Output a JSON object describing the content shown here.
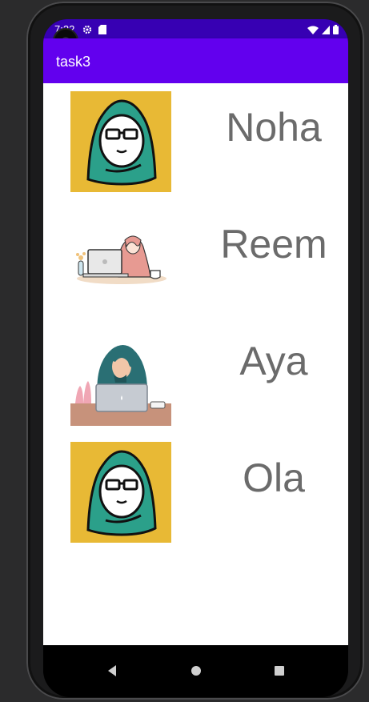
{
  "status_bar": {
    "time": "7:22"
  },
  "app_bar": {
    "title": "task3"
  },
  "list": [
    {
      "name": "Noha",
      "avatar": "hijab-glasses-yellow-avatar"
    },
    {
      "name": "Reem",
      "avatar": "woman-laptop-coffee-illustration"
    },
    {
      "name": "Aya",
      "avatar": "woman-laptop-desk-illustration"
    },
    {
      "name": "Ola",
      "avatar": "hijab-glasses-yellow-avatar"
    }
  ],
  "colors": {
    "status_bar": "#3700b3",
    "app_bar": "#6200ee",
    "name_text": "#6b6b6b",
    "avatar_bg": "#e8b935",
    "hijab": "#2ba08a"
  }
}
